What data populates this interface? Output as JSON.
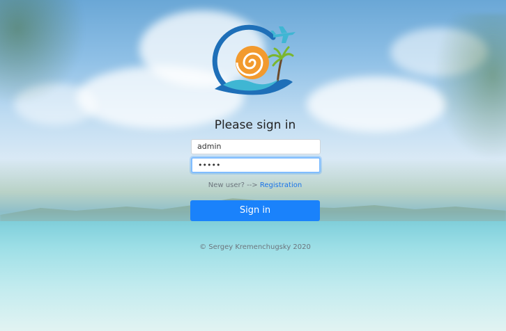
{
  "form": {
    "title": "Please sign in",
    "login_value": "admin",
    "password_value": "•••••",
    "new_user_prompt": "New user? -->",
    "registration_link": "Registration",
    "signin_label": "Sign in",
    "copyright": "© Sergey Kremenchugsky 2020"
  },
  "colors": {
    "primary": "#1a82fb",
    "link": "#1a73e8",
    "logo_orange": "#f29a2e",
    "logo_blue": "#1e6fb8",
    "logo_teal": "#3fb6d3"
  },
  "icons": {
    "logo": "sun-wave-plane-palm-logo"
  }
}
